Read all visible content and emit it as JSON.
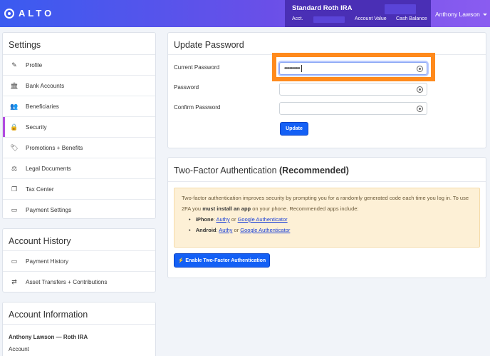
{
  "header": {
    "logo_text": "ALTO",
    "account_name": "Standard Roth IRA",
    "acct_label": "Acct.",
    "account_value_label": "Account Value",
    "cash_balance_label": "Cash Balance",
    "user_name": "Anthony Lawson"
  },
  "settings": {
    "title": "Settings",
    "items": [
      {
        "label": "Profile",
        "icon": "✎"
      },
      {
        "label": "Bank Accounts",
        "icon": "🏛"
      },
      {
        "label": "Beneficiaries",
        "icon": "👥"
      },
      {
        "label": "Security",
        "icon": "🔒"
      },
      {
        "label": "Promotions + Benefits",
        "icon": "🏷"
      },
      {
        "label": "Legal Documents",
        "icon": "⚖"
      },
      {
        "label": "Tax Center",
        "icon": "❐"
      },
      {
        "label": "Payment Settings",
        "icon": "▭"
      }
    ]
  },
  "account_history": {
    "title": "Account History",
    "items": [
      {
        "label": "Payment History",
        "icon": "▭"
      },
      {
        "label": "Asset Transfers + Contributions",
        "icon": "⇄"
      }
    ]
  },
  "account_information": {
    "title": "Account Information",
    "name": "Anthony Lawson — Roth IRA",
    "subtitle": "Account"
  },
  "update_password": {
    "title": "Update Password",
    "current_label": "Current Password",
    "current_value": "••••••••••••",
    "password_label": "Password",
    "confirm_label": "Confirm Password",
    "button": "Update"
  },
  "two_factor": {
    "title_main": "Two-Factor Authentication",
    "title_bold": "(Recommended)",
    "text_1": "Two-factor authentication improves security by prompting you for a randomly generated code each time you log in. To use 2FA you",
    "text_bold": "must install an app",
    "text_2": "on your phone. Recommended apps include:",
    "iphone_label": "iPhone",
    "android_label": "Android",
    "authy": "Authy",
    "or": "or",
    "google_auth": "Google Authenticator",
    "button": "⚡ Enable Two-Factor Authentication"
  },
  "colors": {
    "accent": "#1460f5",
    "highlight": "#ff8a1c",
    "active_marker": "#b24be0"
  }
}
